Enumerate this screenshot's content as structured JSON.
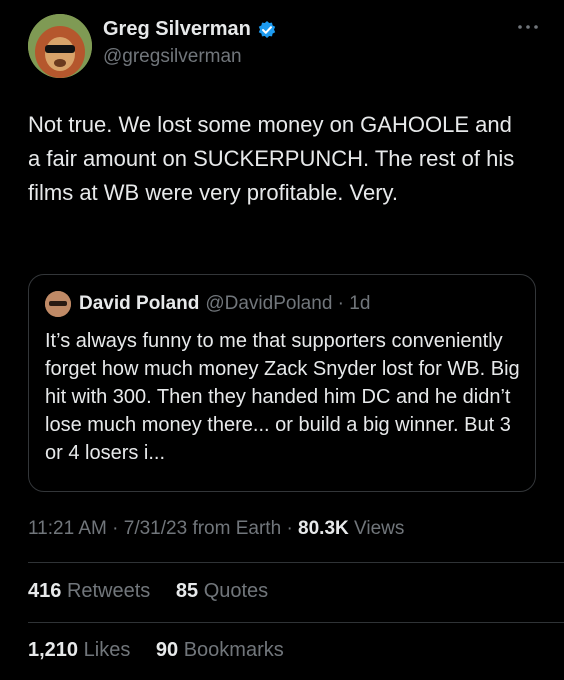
{
  "tweet": {
    "author_name": "Greg Silverman",
    "author_handle": "@gregsilverman",
    "text": "Not true. We lost some money on GAHOOLE and a fair amount on SUCKERPUNCH. The rest of his films at WB were very profitable. Very.",
    "time": "11:21 AM",
    "date": "7/31/23",
    "source": "from Earth",
    "views_count": "80.3K",
    "views_label": "Views"
  },
  "quote": {
    "name": "David Poland",
    "handle": "@DavidPoland",
    "age": "1d",
    "text": "It’s always funny to me that supporters conveniently forget how much money Zack Snyder lost for WB. Big hit with 300. Then they handed him DC and he didn’t lose much money there... or build a big winner. But 3 or 4 losers i..."
  },
  "stats": {
    "retweets_count": "416",
    "retweets_label": "Retweets",
    "quotes_count": "85",
    "quotes_label": "Quotes",
    "likes_count": "1,210",
    "likes_label": "Likes",
    "bookmarks_count": "90",
    "bookmarks_label": "Bookmarks"
  },
  "colors": {
    "background": "#000000",
    "text": "#e7e9ea",
    "muted": "#71767b",
    "verified": "#1d9bf0",
    "border": "#333639"
  },
  "icons": [
    "verified-badge-icon",
    "more-options-icon"
  ]
}
